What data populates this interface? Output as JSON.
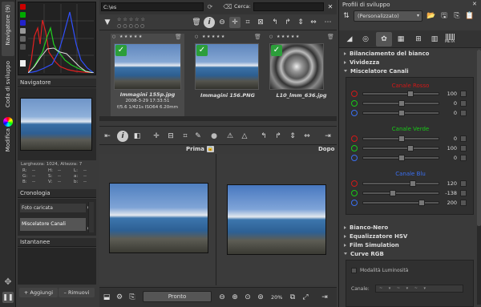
{
  "left_strip": {
    "tabs": [
      "Navigatore (9)",
      "Coda di sviluppo",
      "Modifica"
    ]
  },
  "navigator": {
    "title": "Navigatore",
    "size_line": "Larghezza: 1024, Altezza: 7",
    "rgb_labels": [
      "R:",
      "G:",
      "B:"
    ],
    "hsv_labels": [
      "H:",
      "S:",
      "V:"
    ],
    "lab_labels": [
      "L:",
      "a:",
      "b:"
    ],
    "dash": "--"
  },
  "history": {
    "title": "Cronologia",
    "items": [
      {
        "label": "Foto caricata",
        "value": "0"
      },
      {
        "label": "Miscelatore Canali",
        "value": "00"
      }
    ]
  },
  "snapshots": {
    "title": "Istantanee",
    "add": "Aggiungi",
    "remove": "Rimuovi"
  },
  "browser": {
    "path": "C:\\es",
    "search_label": "Cerca:",
    "search_value": ""
  },
  "thumbnails": [
    {
      "name": "Immagini 155p.jpg",
      "lines": [
        "2008-3-29 17:33:51",
        "f/5.6 1/421s ISO64 6.20mm"
      ],
      "selected": true
    },
    {
      "name": "Immagini 156.PNG",
      "lines": [],
      "selected": false
    },
    {
      "name": "L10_lmm_636.jpg",
      "lines": [],
      "selected": false
    }
  ],
  "compare": {
    "before": "Prima",
    "after": "Dopo"
  },
  "status": {
    "text": "Pronto",
    "zoom": "20%"
  },
  "profiles": {
    "title": "Profili di sviluppo",
    "selected": "(Personalizzato)"
  },
  "tool_tab_label": "META",
  "tools": [
    {
      "label": "Bilanciamento del bianco",
      "open": false
    },
    {
      "label": "Vividezza",
      "open": false
    },
    {
      "label": "Miscelatore Canali",
      "open": true
    }
  ],
  "channels": [
    {
      "title": "Canale Rosso",
      "color": "#d01818",
      "values": [
        "100",
        "0",
        "0"
      ]
    },
    {
      "title": "Canale Verde",
      "color": "#18c818",
      "values": [
        "0",
        "100",
        "0"
      ]
    },
    {
      "title": "Canale Blu",
      "color": "#3a6ff0",
      "values": [
        "120",
        "-138",
        "200"
      ]
    }
  ],
  "tools_after": [
    {
      "label": "Bianco-Nero",
      "open": false
    },
    {
      "label": "Equalizzatore HSV",
      "open": false
    },
    {
      "label": "Film Simulation",
      "open": false
    },
    {
      "label": "Curve RGB",
      "open": true
    }
  ],
  "curve": {
    "luminosity": "Modalità Luminosità",
    "channel_label": "Canale:"
  }
}
